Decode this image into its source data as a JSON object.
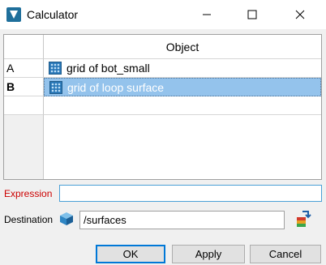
{
  "window": {
    "title": "Calculator",
    "controls": {
      "minimize": "minimize-icon",
      "maximize": "maximize-icon",
      "close": "close-icon"
    }
  },
  "table": {
    "column_header": "Object",
    "rows": [
      {
        "label": "A",
        "value": "grid of bot_small",
        "icon": "grid-icon",
        "selected": false
      },
      {
        "label": "B",
        "value": "grid of loop surface",
        "icon": "grid-icon",
        "selected": true
      }
    ]
  },
  "expression": {
    "label": "Expression",
    "value": ""
  },
  "destination": {
    "label": "Destination",
    "value": "/surfaces",
    "icon": "cube-icon",
    "picker_icon": "pick-object-icon"
  },
  "buttons": {
    "ok": "OK",
    "apply": "Apply",
    "cancel": "Cancel"
  },
  "colors": {
    "selection": "#94c3ec",
    "expression_label": "#cc0000",
    "focus_border": "#4aa0d6",
    "default_button_border": "#0078d7"
  }
}
